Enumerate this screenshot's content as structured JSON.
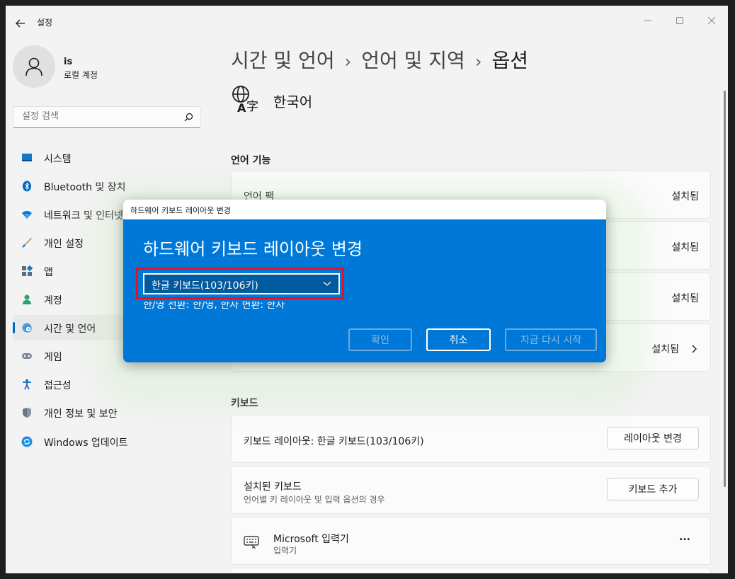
{
  "app": {
    "title": "설정"
  },
  "user": {
    "name": "is",
    "account_type": "로컬 계정"
  },
  "search": {
    "placeholder": "설정 검색"
  },
  "sidebar": {
    "items": [
      {
        "label": "시스템",
        "icon": "monitor-icon"
      },
      {
        "label": "Bluetooth 및 장치",
        "icon": "bluetooth-icon"
      },
      {
        "label": "네트워크 및 인터넷",
        "icon": "wifi-icon"
      },
      {
        "label": "개인 설정",
        "icon": "brush-icon"
      },
      {
        "label": "앱",
        "icon": "apps-icon"
      },
      {
        "label": "계정",
        "icon": "person-icon"
      },
      {
        "label": "시간 및 언어",
        "icon": "globe-clock-icon",
        "active": true
      },
      {
        "label": "게임",
        "icon": "gamepad-icon"
      },
      {
        "label": "접근성",
        "icon": "accessibility-icon"
      },
      {
        "label": "개인 정보 및 보안",
        "icon": "shield-icon"
      },
      {
        "label": "Windows 업데이트",
        "icon": "update-icon"
      }
    ]
  },
  "breadcrumb": {
    "level1": "시간 및 언어",
    "level2": "언어 및 지역",
    "current": "옵션"
  },
  "language": {
    "name": "한국어",
    "icon": "language-icon"
  },
  "language_features": {
    "title": "언어 기능",
    "rows": [
      {
        "label": "언어 팩",
        "status": "설치됨"
      },
      {
        "label": "",
        "status": "설치됨"
      },
      {
        "label": "",
        "status": "설치됨"
      },
      {
        "label": "",
        "status": "설치됨"
      }
    ]
  },
  "keyboard": {
    "title": "키보드",
    "layout_label": "키보드 레이아웃: 한글 키보드(103/106키)",
    "layout_button": "레이아웃 변경",
    "installed_label": "설치된 키보드",
    "installed_sub": "언어별 키 레이아웃 및 입력 옵션의 경우",
    "add_button": "키보드 추가",
    "ime_name": "Microsoft 입력기",
    "ime_sub": "입력기",
    "more": "..."
  },
  "dialog": {
    "window_title": "하드웨어 키보드 레이아웃 변경",
    "heading": "하드웨어 키보드 레이아웃 변경",
    "selected_layout": "한글 키보드(103/106키)",
    "note": "한/영 전환: 한/영, 한자 변환: 한자",
    "ok": "확인",
    "cancel": "취소",
    "restart": "지금 다시 시작"
  },
  "colors": {
    "accent": "#0078d7",
    "highlight": "#e81123",
    "icon_blue": "#0067c0"
  }
}
